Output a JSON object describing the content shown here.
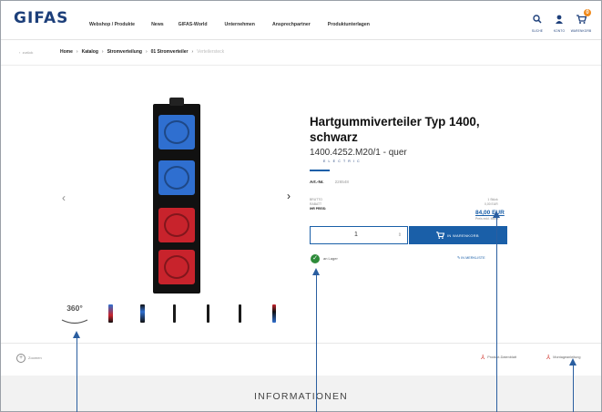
{
  "header": {
    "logo_text": "GIFAS",
    "logo_sub": "ELECTRIC",
    "nav": [
      "Webshop / Produkte",
      "News",
      "GIFAS-World",
      "Unternehmen",
      "Ansprechpartner",
      "Produktunterlagen"
    ],
    "icons": [
      {
        "name": "search-icon",
        "label": "SUCHE"
      },
      {
        "name": "user-icon",
        "label": "KONTO"
      },
      {
        "name": "cart-icon",
        "label": "WARENKORB",
        "badge": "0"
      }
    ]
  },
  "breadcrumb": {
    "back_label": "zurück",
    "items": [
      "Home",
      "Katalog",
      "Stromverteilung",
      "01 Stromverteiler"
    ],
    "current": "Verteilersteck"
  },
  "product": {
    "title": "Hartgummiverteiler Typ 1400, schwarz",
    "subtitle": "1400.4252.M20/1 - quer",
    "art_label": "Art.-Nr.",
    "art_value": "226548",
    "price_meta_left": [
      "BRUTTO",
      "RABATT",
      "IHR PREIS:"
    ],
    "price_meta_right": [
      "1 Stück",
      "0,00 EUR",
      ""
    ],
    "price": "84,00 EUR",
    "price_note": "Preis exkl. MwSt.",
    "quantity": "1",
    "cart_button": "IN WARENKORB",
    "stock": "an Lager",
    "wishlist": "IN MERKLISTE",
    "zoom": "Zoomen",
    "docs": [
      "Produkt-Datenblatt",
      "Montageanleitung"
    ],
    "thumb_360": "360°",
    "socket_colors": [
      "#2f6fd0",
      "#2f6fd0",
      "#c8232c",
      "#c8232c"
    ]
  },
  "info_heading": "INFORMATIONEN",
  "colors": {
    "brand": "#1d3f7a",
    "accent": "#1a5fa8",
    "stock": "#2e8b3a",
    "pdf": "#d0342c",
    "annotation": "#2a5ea0"
  }
}
